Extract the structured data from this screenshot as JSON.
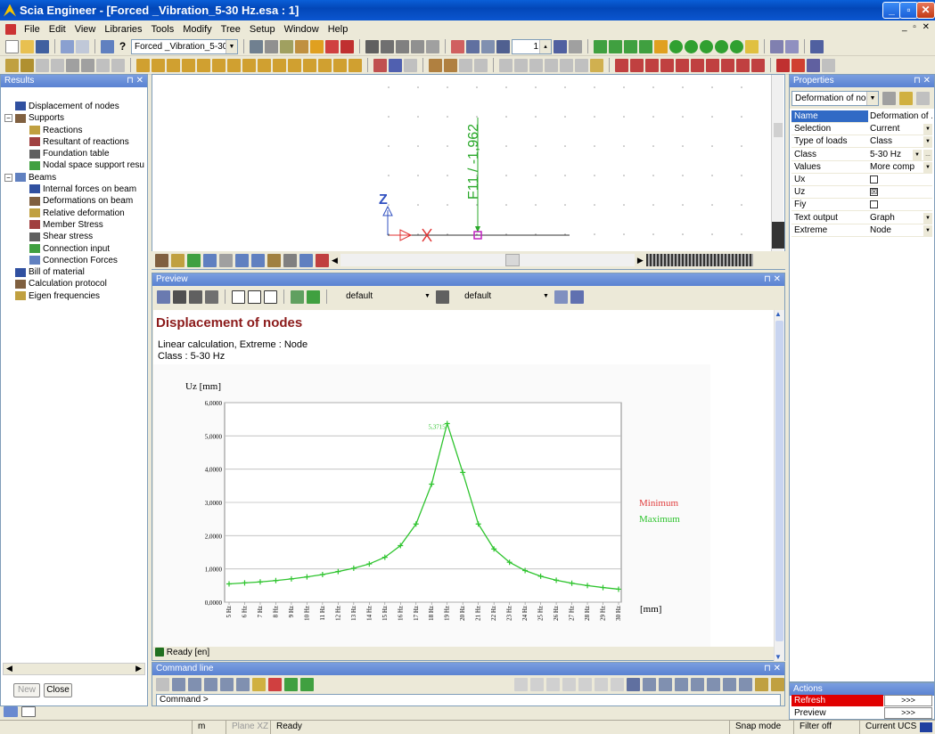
{
  "window": {
    "title": "Scia Engineer - [Forced _Vibration_5-30 Hz.esa : 1]",
    "min": "_",
    "max": "▫",
    "close": "✕"
  },
  "menu": {
    "items": [
      "File",
      "Edit",
      "View",
      "Libraries",
      "Tools",
      "Modify",
      "Tree",
      "Setup",
      "Window",
      "Help"
    ],
    "mdi": "_ ▫ ✕"
  },
  "toolbar1": {
    "project_combo": "Forced _Vibration_5-30 H",
    "spinner_value": "1"
  },
  "results_panel": {
    "title": "Results",
    "items": [
      {
        "label": "Displacement of nodes",
        "level": 1,
        "expander": ""
      },
      {
        "label": "Supports",
        "level": 0,
        "expander": "−"
      },
      {
        "label": "Reactions",
        "level": 2,
        "expander": ""
      },
      {
        "label": "Resultant of reactions",
        "level": 2,
        "expander": ""
      },
      {
        "label": "Foundation table",
        "level": 2,
        "expander": ""
      },
      {
        "label": "Nodal space support resu",
        "level": 2,
        "expander": ""
      },
      {
        "label": "Beams",
        "level": 0,
        "expander": "−"
      },
      {
        "label": "Internal forces on beam",
        "level": 2,
        "expander": ""
      },
      {
        "label": "Deformations on beam",
        "level": 2,
        "expander": ""
      },
      {
        "label": "Relative deformation",
        "level": 2,
        "expander": ""
      },
      {
        "label": "Member Stress",
        "level": 2,
        "expander": ""
      },
      {
        "label": "Shear stress",
        "level": 2,
        "expander": ""
      },
      {
        "label": "Connection input",
        "level": 2,
        "expander": ""
      },
      {
        "label": "Connection Forces",
        "level": 2,
        "expander": ""
      },
      {
        "label": "Bill of material",
        "level": 1,
        "expander": ""
      },
      {
        "label": "Calculation protocol",
        "level": 1,
        "expander": ""
      },
      {
        "label": "Eigen frequencies",
        "level": 1,
        "expander": ""
      }
    ],
    "new_button": "New",
    "close_button": "Close"
  },
  "view": {
    "load_label": "F11 / -1,962",
    "axis_label": "Z"
  },
  "preview_panel": {
    "title": "Preview",
    "combo1": "default",
    "combo2": "default",
    "doc_title": "Displacement of nodes",
    "line1": "Linear calculation, Extreme : Node",
    "line2": "Class : 5-30 Hz",
    "status": "Ready [en]"
  },
  "chart_data": {
    "type": "line",
    "ylabel": "Uz [mm]",
    "xunit": "[mm]",
    "categories": [
      "5 Hz",
      "6 Hz",
      "7 Hz",
      "8 Hz",
      "9 Hz",
      "10 Hz",
      "11 Hz",
      "12 Hz",
      "13 Hz",
      "14 Hz",
      "15 Hz",
      "16 Hz",
      "17 Hz",
      "18 Hz",
      "19 Hz",
      "20 Hz",
      "21 Hz",
      "22 Hz",
      "23 Hz",
      "24 Hz",
      "25 Hz",
      "26 Hz",
      "27 Hz",
      "28 Hz",
      "29 Hz",
      "30 Hz"
    ],
    "series": [
      {
        "name": "Maximum",
        "values": [
          0.55,
          0.58,
          0.61,
          0.65,
          0.7,
          0.76,
          0.83,
          0.92,
          1.02,
          1.15,
          1.35,
          1.7,
          2.35,
          3.55,
          5.3715,
          3.9,
          2.35,
          1.6,
          1.2,
          0.95,
          0.78,
          0.66,
          0.57,
          0.5,
          0.44,
          0.39
        ]
      }
    ],
    "legend": [
      "Minimum",
      "Maximum"
    ],
    "legend_colors": [
      "#e04040",
      "#2ec42e"
    ],
    "peak_label": "5,3715",
    "yticks": [
      "0,0000",
      "1,0000",
      "2,0000",
      "3,0000",
      "4,0000",
      "5,0000",
      "6,0000"
    ],
    "ylim": [
      0,
      6
    ]
  },
  "command_panel": {
    "title": "Command line",
    "prompt": "Command >"
  },
  "properties_panel": {
    "title": "Properties",
    "combo": "Deformation of node",
    "rows": [
      {
        "name": "Name",
        "value": "Deformation of ...",
        "type": "text"
      },
      {
        "name": "Selection",
        "value": "Current",
        "type": "dd"
      },
      {
        "name": "Type of loads",
        "value": "Class",
        "type": "dd"
      },
      {
        "name": "Class",
        "value": "5-30 Hz",
        "type": "dd2"
      },
      {
        "name": "Values",
        "value": "More comp",
        "type": "dd"
      },
      {
        "name": "Ux",
        "value": "",
        "type": "check"
      },
      {
        "name": "Uz",
        "value": "☒",
        "type": "check"
      },
      {
        "name": "Fiy",
        "value": "",
        "type": "check"
      },
      {
        "name": "Text output",
        "value": "Graph",
        "type": "dd"
      },
      {
        "name": "Extreme",
        "value": "Node",
        "type": "dd"
      }
    ]
  },
  "actions_panel": {
    "title": "Actions",
    "refresh": "Refresh",
    "preview": "Preview",
    "go": ">>>"
  },
  "statusbar": {
    "units": "m",
    "plane": "Plane XZ",
    "state": "Ready",
    "snap": "Snap mode",
    "filter": "Filter off",
    "ucs": "Current UCS"
  }
}
